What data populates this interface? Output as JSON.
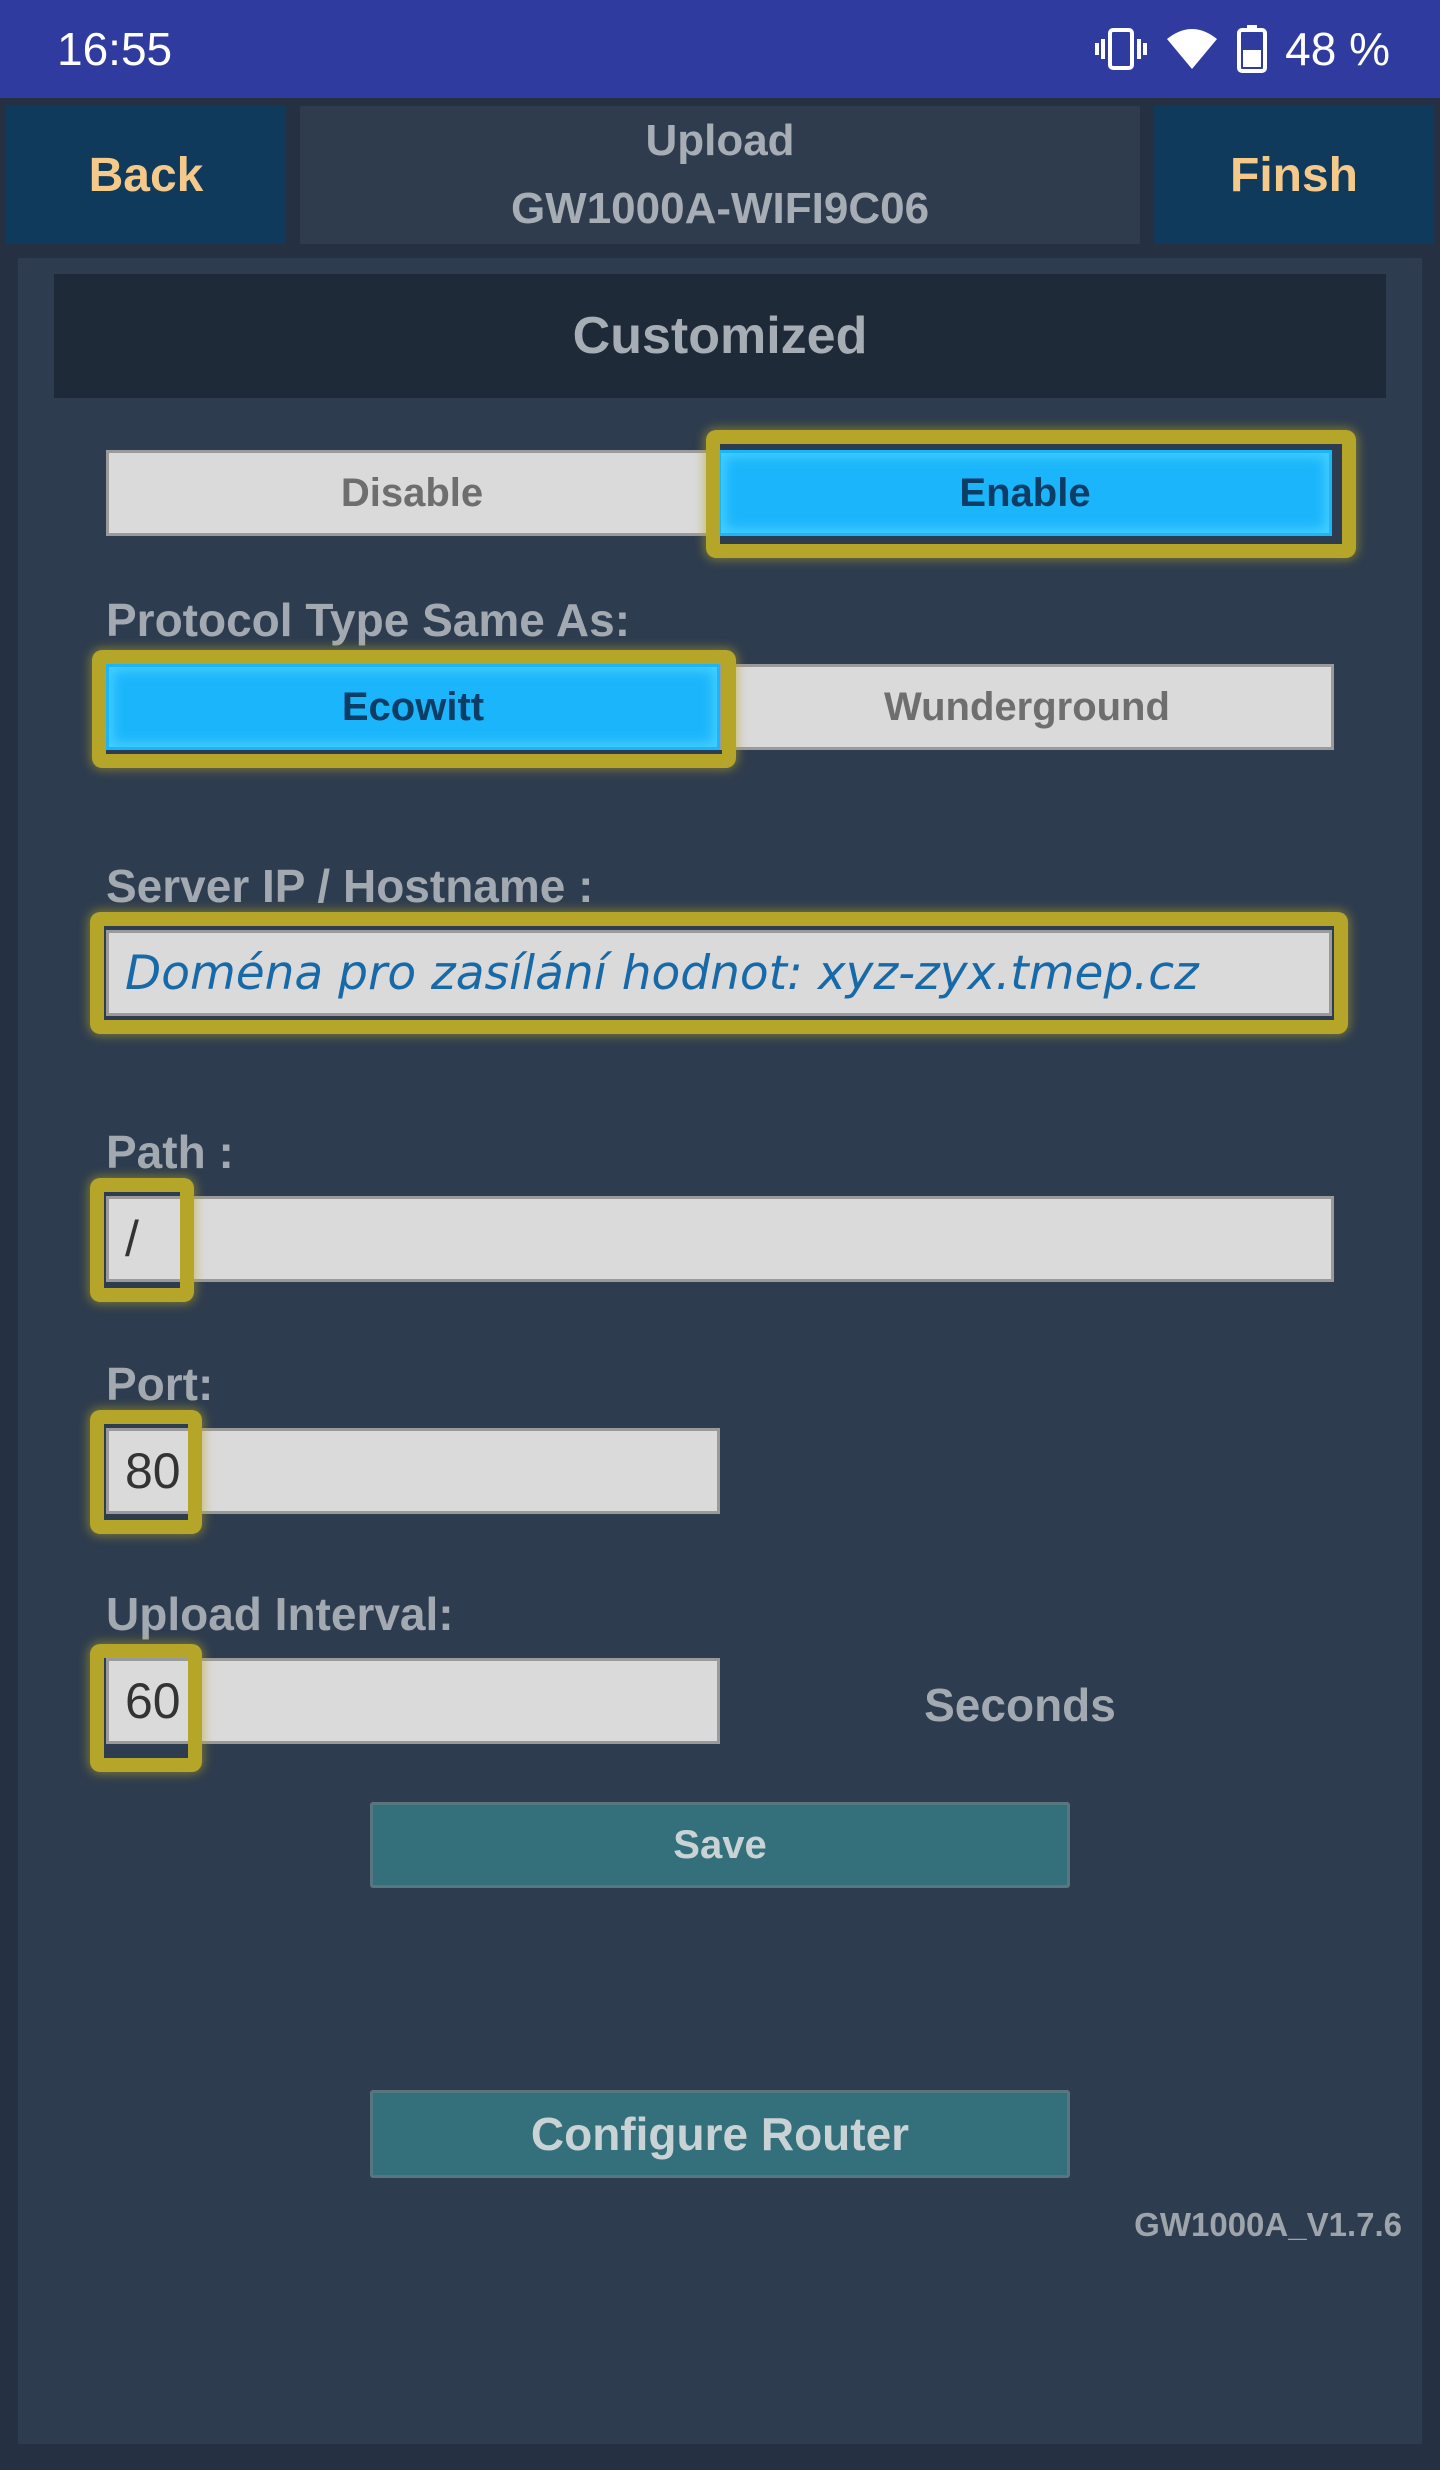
{
  "status_bar": {
    "time": "16:55",
    "battery_percent": "48 %",
    "icons": [
      "vibrate-icon",
      "wifi-icon",
      "battery-icon"
    ]
  },
  "header": {
    "back_label": "Back",
    "finish_label": "Finsh",
    "title_line1": "Upload",
    "title_line2": "GW1000A-WIFI9C06"
  },
  "section": {
    "title": "Customized"
  },
  "toggle": {
    "disable_label": "Disable",
    "enable_label": "Enable",
    "selected": "Enable"
  },
  "protocol": {
    "label": "Protocol Type Same As:",
    "options": [
      "Ecowitt",
      "Wunderground"
    ],
    "selected": "Ecowitt"
  },
  "server": {
    "label": "Server IP / Hostname :",
    "value": "Doména pro zasílání hodnot: xyz-zyx.tmep.cz"
  },
  "path": {
    "label": "Path :",
    "value": "/"
  },
  "port": {
    "label": "Port:",
    "value": "80"
  },
  "interval": {
    "label": "Upload Interval:",
    "value": "60",
    "unit": "Seconds"
  },
  "actions": {
    "save_label": "Save",
    "configure_router_label": "Configure Router"
  },
  "version": "GW1000A_V1.7.6",
  "colors": {
    "status_bar": "#2f3b9e",
    "header_button_bg": "#0f3a5c",
    "header_button_text": "#f4c98a",
    "selected_segment": "#1ab5fb",
    "highlight": "#b5a62a",
    "action_button": "#33707c"
  }
}
